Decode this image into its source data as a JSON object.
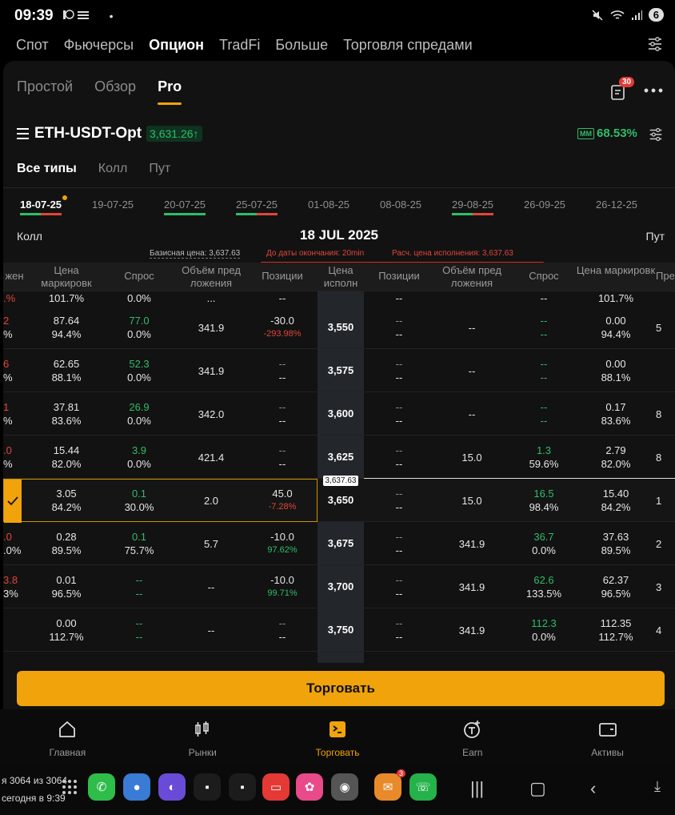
{
  "status": {
    "time": "09:39",
    "left_icons": "• ",
    "battery": "6"
  },
  "top_nav": {
    "items": [
      "Спот",
      "Фьючерсы",
      "Опцион",
      "TradFi",
      "Больше",
      "Торговля спредами"
    ]
  },
  "mode_tabs": [
    "Простой",
    "Обзор",
    "Pro"
  ],
  "orders_badge": "30",
  "symbol": {
    "name": "ETH-USDT-Opt",
    "price": "3,631.26↑",
    "iv_tag": "MM",
    "iv_value": "68.53%"
  },
  "type_tabs": [
    "Все типы",
    "Колл",
    "Пут"
  ],
  "dates": [
    "18-07-25",
    "19-07-25",
    "20-07-25",
    "25-07-25",
    "01-08-25",
    "08-08-25",
    "29-08-25",
    "26-09-25",
    "26-12-25"
  ],
  "expiry": {
    "call": "Колл",
    "date": "18 JUL 2025",
    "put": "Пут"
  },
  "info": {
    "base": "Базисная цена: 3,637.63",
    "time_left": "До даты окончания: 20min",
    "est_price": "Расч. цена исполнения: 3,637.63"
  },
  "headers": {
    "c_first": "жен",
    "c_mark": "Цена маркировк",
    "c_bid": "Спрос",
    "c_vol": "Объём пред ложения",
    "c_pos": "Позиции",
    "strike": "Цена исполн",
    "p_pos": "Позиции",
    "p_vol": "Объём пред ложения",
    "p_bid": "Спрос",
    "p_mark": "Цена маркировк",
    "p_last": "Пре"
  },
  "top_partial": {
    "c_first": ".%",
    "c_mark": "101.7%",
    "c_bid": "0.0%",
    "c_vol": "...",
    "c_pos": "--",
    "p_pos": "--",
    "p_bid": "--",
    "p_mark": "101.7%"
  },
  "rows": [
    {
      "c_first_a": "2",
      "c_first_b": "%",
      "c_mark_a": "87.64",
      "c_mark_b": "94.4%",
      "c_bid_a": "77.0",
      "c_bid_b": "0.0%",
      "c_vol": "341.9",
      "c_pos_a": "-30.0",
      "c_pos_b": "-293.98%",
      "strike": "3,550",
      "p_pos_a": "--",
      "p_pos_b": "--",
      "p_vol": "--",
      "p_bid_a": "--",
      "p_bid_b": "--",
      "p_mark_a": "0.00",
      "p_mark_b": "94.4%",
      "p_last": "5"
    },
    {
      "c_first_a": "6",
      "c_first_b": "%",
      "c_mark_a": "62.65",
      "c_mark_b": "88.1%",
      "c_bid_a": "52.3",
      "c_bid_b": "0.0%",
      "c_vol": "341.9",
      "c_pos_a": "--",
      "c_pos_b": "--",
      "strike": "3,575",
      "p_pos_a": "--",
      "p_pos_b": "--",
      "p_vol": "--",
      "p_bid_a": "--",
      "p_bid_b": "--",
      "p_mark_a": "0.00",
      "p_mark_b": "88.1%",
      "p_last": ""
    },
    {
      "c_first_a": "1",
      "c_first_b": "%",
      "c_mark_a": "37.81",
      "c_mark_b": "83.6%",
      "c_bid_a": "26.9",
      "c_bid_b": "0.0%",
      "c_vol": "342.0",
      "c_pos_a": "--",
      "c_pos_b": "--",
      "strike": "3,600",
      "p_pos_a": "--",
      "p_pos_b": "--",
      "p_vol": "--",
      "p_bid_a": "--",
      "p_bid_b": "--",
      "p_mark_a": "0.17",
      "p_mark_b": "83.6%",
      "p_last": "8"
    },
    {
      "c_first_a": ".0",
      "c_first_b": "%",
      "c_mark_a": "15.44",
      "c_mark_b": "82.0%",
      "c_bid_a": "3.9",
      "c_bid_b": "0.0%",
      "c_vol": "421.4",
      "c_pos_a": "--",
      "c_pos_b": "--",
      "strike": "3,625",
      "p_pos_a": "--",
      "p_pos_b": "--",
      "p_vol": "15.0",
      "p_bid_a": "1.3",
      "p_bid_b": "59.6%",
      "p_mark_a": "2.79",
      "p_mark_b": "82.0%",
      "p_last": "8"
    },
    {
      "c_first_a": "",
      "c_first_b": "",
      "c_mark_a": "3.05",
      "c_mark_b": "84.2%",
      "c_bid_a": "0.1",
      "c_bid_b": "30.0%",
      "c_vol": "2.0",
      "c_pos_a": "45.0",
      "c_pos_b": "-7.28%",
      "strike": "3,650",
      "p_pos_a": "--",
      "p_pos_b": "--",
      "p_vol": "15.0",
      "p_bid_a": "16.5",
      "p_bid_b": "98.4%",
      "p_mark_a": "15.40",
      "p_mark_b": "84.2%",
      "p_last": "1"
    },
    {
      "c_first_a": ".0",
      "c_first_b": ".0%",
      "c_mark_a": "0.28",
      "c_mark_b": "89.5%",
      "c_bid_a": "0.1",
      "c_bid_b": "75.7%",
      "c_vol": "5.7",
      "c_pos_a": "-10.0",
      "c_pos_b": "97.62%",
      "strike": "3,675",
      "p_pos_a": "--",
      "p_pos_b": "--",
      "p_vol": "341.9",
      "p_bid_a": "36.7",
      "p_bid_b": "0.0%",
      "p_mark_a": "37.63",
      "p_mark_b": "89.5%",
      "p_last": "2"
    },
    {
      "c_first_a": "3.8",
      "c_first_b": "3%",
      "c_mark_a": "0.01",
      "c_mark_b": "96.5%",
      "c_bid_a": "--",
      "c_bid_b": "--",
      "c_vol": "--",
      "c_pos_a": "-10.0",
      "c_pos_b": "99.71%",
      "strike": "3,700",
      "p_pos_a": "--",
      "p_pos_b": "--",
      "p_vol": "341.9",
      "p_bid_a": "62.6",
      "p_bid_b": "133.5%",
      "p_mark_a": "62.37",
      "p_mark_b": "96.5%",
      "p_last": "3"
    },
    {
      "c_first_a": "",
      "c_first_b": "",
      "c_mark_a": "0.00",
      "c_mark_b": "112.7%",
      "c_bid_a": "--",
      "c_bid_b": "--",
      "c_vol": "--",
      "c_pos_a": "--",
      "c_pos_b": "--",
      "strike": "3,750",
      "p_pos_a": "--",
      "p_pos_b": "--",
      "p_vol": "341.9",
      "p_bid_a": "112.3",
      "p_bid_b": "0.0%",
      "p_mark_a": "112.35",
      "p_mark_b": "112.7%",
      "p_last": "4"
    }
  ],
  "index_price_marker": "3,637.63",
  "trade_button": "Торговать",
  "bottom_nav": [
    "Главная",
    "Рынки",
    "Торговать",
    "Earn",
    "Активы"
  ],
  "taskbar": {
    "notif_line1": "я 3064 из 3064",
    "notif_line2": "сегодня в 9:39",
    "mail_badge": "3"
  },
  "colors": {
    "accent": "#f0a30a",
    "green": "#2fbd6a",
    "red": "#e0463a",
    "background": "#121212"
  }
}
